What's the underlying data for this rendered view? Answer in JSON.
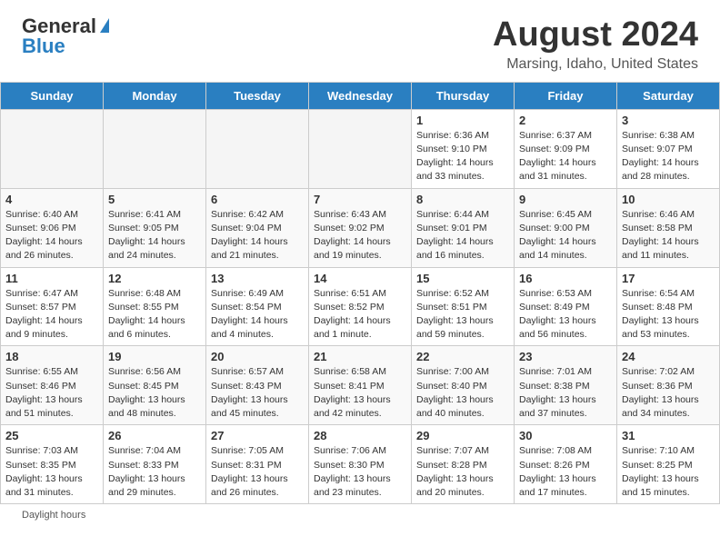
{
  "header": {
    "logo_general": "General",
    "logo_blue": "Blue",
    "month_year": "August 2024",
    "location": "Marsing, Idaho, United States"
  },
  "days_of_week": [
    "Sunday",
    "Monday",
    "Tuesday",
    "Wednesday",
    "Thursday",
    "Friday",
    "Saturday"
  ],
  "weeks": [
    [
      {
        "num": "",
        "info": ""
      },
      {
        "num": "",
        "info": ""
      },
      {
        "num": "",
        "info": ""
      },
      {
        "num": "",
        "info": ""
      },
      {
        "num": "1",
        "info": "Sunrise: 6:36 AM\nSunset: 9:10 PM\nDaylight: 14 hours\nand 33 minutes."
      },
      {
        "num": "2",
        "info": "Sunrise: 6:37 AM\nSunset: 9:09 PM\nDaylight: 14 hours\nand 31 minutes."
      },
      {
        "num": "3",
        "info": "Sunrise: 6:38 AM\nSunset: 9:07 PM\nDaylight: 14 hours\nand 28 minutes."
      }
    ],
    [
      {
        "num": "4",
        "info": "Sunrise: 6:40 AM\nSunset: 9:06 PM\nDaylight: 14 hours\nand 26 minutes."
      },
      {
        "num": "5",
        "info": "Sunrise: 6:41 AM\nSunset: 9:05 PM\nDaylight: 14 hours\nand 24 minutes."
      },
      {
        "num": "6",
        "info": "Sunrise: 6:42 AM\nSunset: 9:04 PM\nDaylight: 14 hours\nand 21 minutes."
      },
      {
        "num": "7",
        "info": "Sunrise: 6:43 AM\nSunset: 9:02 PM\nDaylight: 14 hours\nand 19 minutes."
      },
      {
        "num": "8",
        "info": "Sunrise: 6:44 AM\nSunset: 9:01 PM\nDaylight: 14 hours\nand 16 minutes."
      },
      {
        "num": "9",
        "info": "Sunrise: 6:45 AM\nSunset: 9:00 PM\nDaylight: 14 hours\nand 14 minutes."
      },
      {
        "num": "10",
        "info": "Sunrise: 6:46 AM\nSunset: 8:58 PM\nDaylight: 14 hours\nand 11 minutes."
      }
    ],
    [
      {
        "num": "11",
        "info": "Sunrise: 6:47 AM\nSunset: 8:57 PM\nDaylight: 14 hours\nand 9 minutes."
      },
      {
        "num": "12",
        "info": "Sunrise: 6:48 AM\nSunset: 8:55 PM\nDaylight: 14 hours\nand 6 minutes."
      },
      {
        "num": "13",
        "info": "Sunrise: 6:49 AM\nSunset: 8:54 PM\nDaylight: 14 hours\nand 4 minutes."
      },
      {
        "num": "14",
        "info": "Sunrise: 6:51 AM\nSunset: 8:52 PM\nDaylight: 14 hours\nand 1 minute."
      },
      {
        "num": "15",
        "info": "Sunrise: 6:52 AM\nSunset: 8:51 PM\nDaylight: 13 hours\nand 59 minutes."
      },
      {
        "num": "16",
        "info": "Sunrise: 6:53 AM\nSunset: 8:49 PM\nDaylight: 13 hours\nand 56 minutes."
      },
      {
        "num": "17",
        "info": "Sunrise: 6:54 AM\nSunset: 8:48 PM\nDaylight: 13 hours\nand 53 minutes."
      }
    ],
    [
      {
        "num": "18",
        "info": "Sunrise: 6:55 AM\nSunset: 8:46 PM\nDaylight: 13 hours\nand 51 minutes."
      },
      {
        "num": "19",
        "info": "Sunrise: 6:56 AM\nSunset: 8:45 PM\nDaylight: 13 hours\nand 48 minutes."
      },
      {
        "num": "20",
        "info": "Sunrise: 6:57 AM\nSunset: 8:43 PM\nDaylight: 13 hours\nand 45 minutes."
      },
      {
        "num": "21",
        "info": "Sunrise: 6:58 AM\nSunset: 8:41 PM\nDaylight: 13 hours\nand 42 minutes."
      },
      {
        "num": "22",
        "info": "Sunrise: 7:00 AM\nSunset: 8:40 PM\nDaylight: 13 hours\nand 40 minutes."
      },
      {
        "num": "23",
        "info": "Sunrise: 7:01 AM\nSunset: 8:38 PM\nDaylight: 13 hours\nand 37 minutes."
      },
      {
        "num": "24",
        "info": "Sunrise: 7:02 AM\nSunset: 8:36 PM\nDaylight: 13 hours\nand 34 minutes."
      }
    ],
    [
      {
        "num": "25",
        "info": "Sunrise: 7:03 AM\nSunset: 8:35 PM\nDaylight: 13 hours\nand 31 minutes."
      },
      {
        "num": "26",
        "info": "Sunrise: 7:04 AM\nSunset: 8:33 PM\nDaylight: 13 hours\nand 29 minutes."
      },
      {
        "num": "27",
        "info": "Sunrise: 7:05 AM\nSunset: 8:31 PM\nDaylight: 13 hours\nand 26 minutes."
      },
      {
        "num": "28",
        "info": "Sunrise: 7:06 AM\nSunset: 8:30 PM\nDaylight: 13 hours\nand 23 minutes."
      },
      {
        "num": "29",
        "info": "Sunrise: 7:07 AM\nSunset: 8:28 PM\nDaylight: 13 hours\nand 20 minutes."
      },
      {
        "num": "30",
        "info": "Sunrise: 7:08 AM\nSunset: 8:26 PM\nDaylight: 13 hours\nand 17 minutes."
      },
      {
        "num": "31",
        "info": "Sunrise: 7:10 AM\nSunset: 8:25 PM\nDaylight: 13 hours\nand 15 minutes."
      }
    ]
  ],
  "footer": {
    "daylight_label": "Daylight hours"
  }
}
